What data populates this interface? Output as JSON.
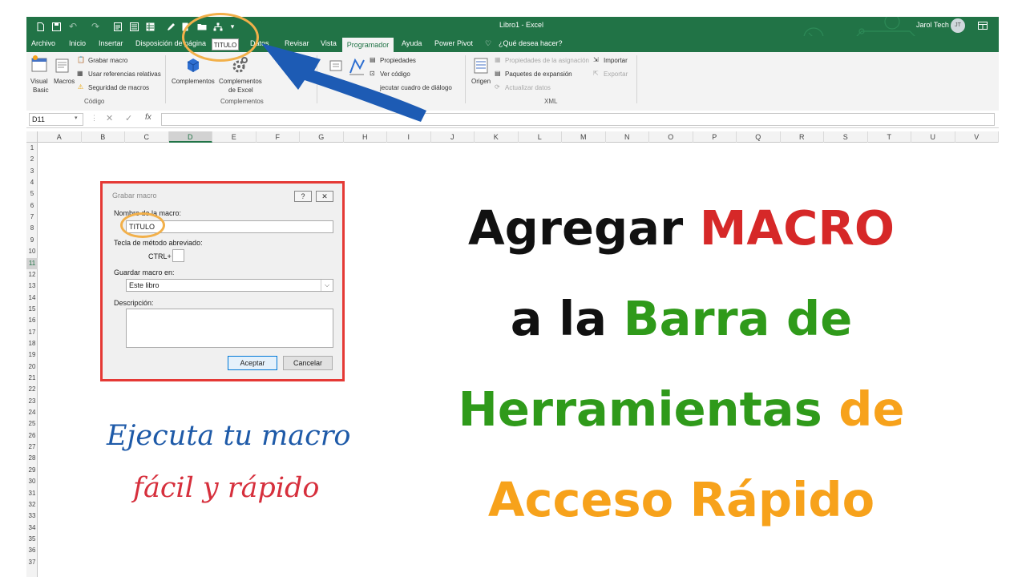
{
  "window": {
    "title": "Libro1 - Excel",
    "user_name": "Jarol Tech",
    "user_initials": "JT"
  },
  "qat": {
    "titulo_button": "TITULO",
    "customize_glyph": "▾"
  },
  "tabs": [
    "Archivo",
    "Inicio",
    "Insertar",
    "Disposición de página",
    "Datos",
    "Revisar",
    "Vista",
    "Programador",
    "Ayuda",
    "Power Pivot",
    "¿Qué desea hacer?"
  ],
  "active_tab": "Programador",
  "ribbon": {
    "codigo": {
      "visual_basic_1": "Visual",
      "visual_basic_2": "Basic",
      "macros": "Macros",
      "grabar_macro": "Grabar macro",
      "usar_referencias": "Usar referencias relativas",
      "seguridad": "Seguridad de macros",
      "label": "Código"
    },
    "complementos": {
      "complementos": "Complementos",
      "complementos_excel_1": "Complementos",
      "complementos_excel_2": "de Excel",
      "label": "Complementos"
    },
    "controles": {
      "propiedades": "Propiedades",
      "ver_codigo": "Ver código",
      "ejecutar_dialogo": "jecutar cuadro de diálogo"
    },
    "xml": {
      "origen": "Origen",
      "prop_asignacion": "Propiedades de la asignación",
      "paquetes": "Paquetes de expansión",
      "actualizar": "Actualizar datos",
      "importar": "Importar",
      "exportar": "Exportar",
      "label": "XML"
    }
  },
  "formula_bar": {
    "name_box": "D11",
    "fx": "fx"
  },
  "columns": [
    "A",
    "B",
    "C",
    "D",
    "E",
    "F",
    "G",
    "H",
    "I",
    "J",
    "K",
    "L",
    "M",
    "N",
    "O",
    "P",
    "Q",
    "R",
    "S",
    "T",
    "U",
    "V"
  ],
  "selected_column": "D",
  "rows": [
    "1",
    "2",
    "3",
    "4",
    "5",
    "6",
    "7",
    "8",
    "9",
    "10",
    "11",
    "12",
    "13",
    "14",
    "15",
    "16",
    "17",
    "18",
    "19",
    "20",
    "21",
    "22",
    "23",
    "24",
    "25",
    "26",
    "27",
    "28",
    "29",
    "30",
    "31",
    "32",
    "33",
    "34",
    "35",
    "36",
    "37"
  ],
  "selected_row": "11",
  "dialog": {
    "title": "Grabar macro",
    "help_glyph": "?",
    "close_glyph": "✕",
    "nombre_label": "Nombre de la macro:",
    "nombre_value": "TITULO",
    "tecla_label": "Tecla de método abreviado:",
    "ctrl_label": "CTRL+",
    "guardar_label": "Guardar macro en:",
    "guardar_value": "Este libro",
    "descripcion_label": "Descripción:",
    "aceptar": "Aceptar",
    "cancelar": "Cancelar"
  },
  "headline": {
    "l1a": "Agregar ",
    "l1b": "MACRO",
    "l2a": "a la ",
    "l2b": "Barra de",
    "l3a": "Herramientas ",
    "l3b": "de",
    "l4": "Acceso Rápido"
  },
  "tagline": {
    "line1": "Ejecuta tu macro",
    "line2": "fácil y rápido"
  },
  "colors": {
    "excel_green": "#217346",
    "highlight_orange": "#f2b04a",
    "arrow_blue": "#1d5bb4",
    "dialog_border_red": "#e53935"
  }
}
